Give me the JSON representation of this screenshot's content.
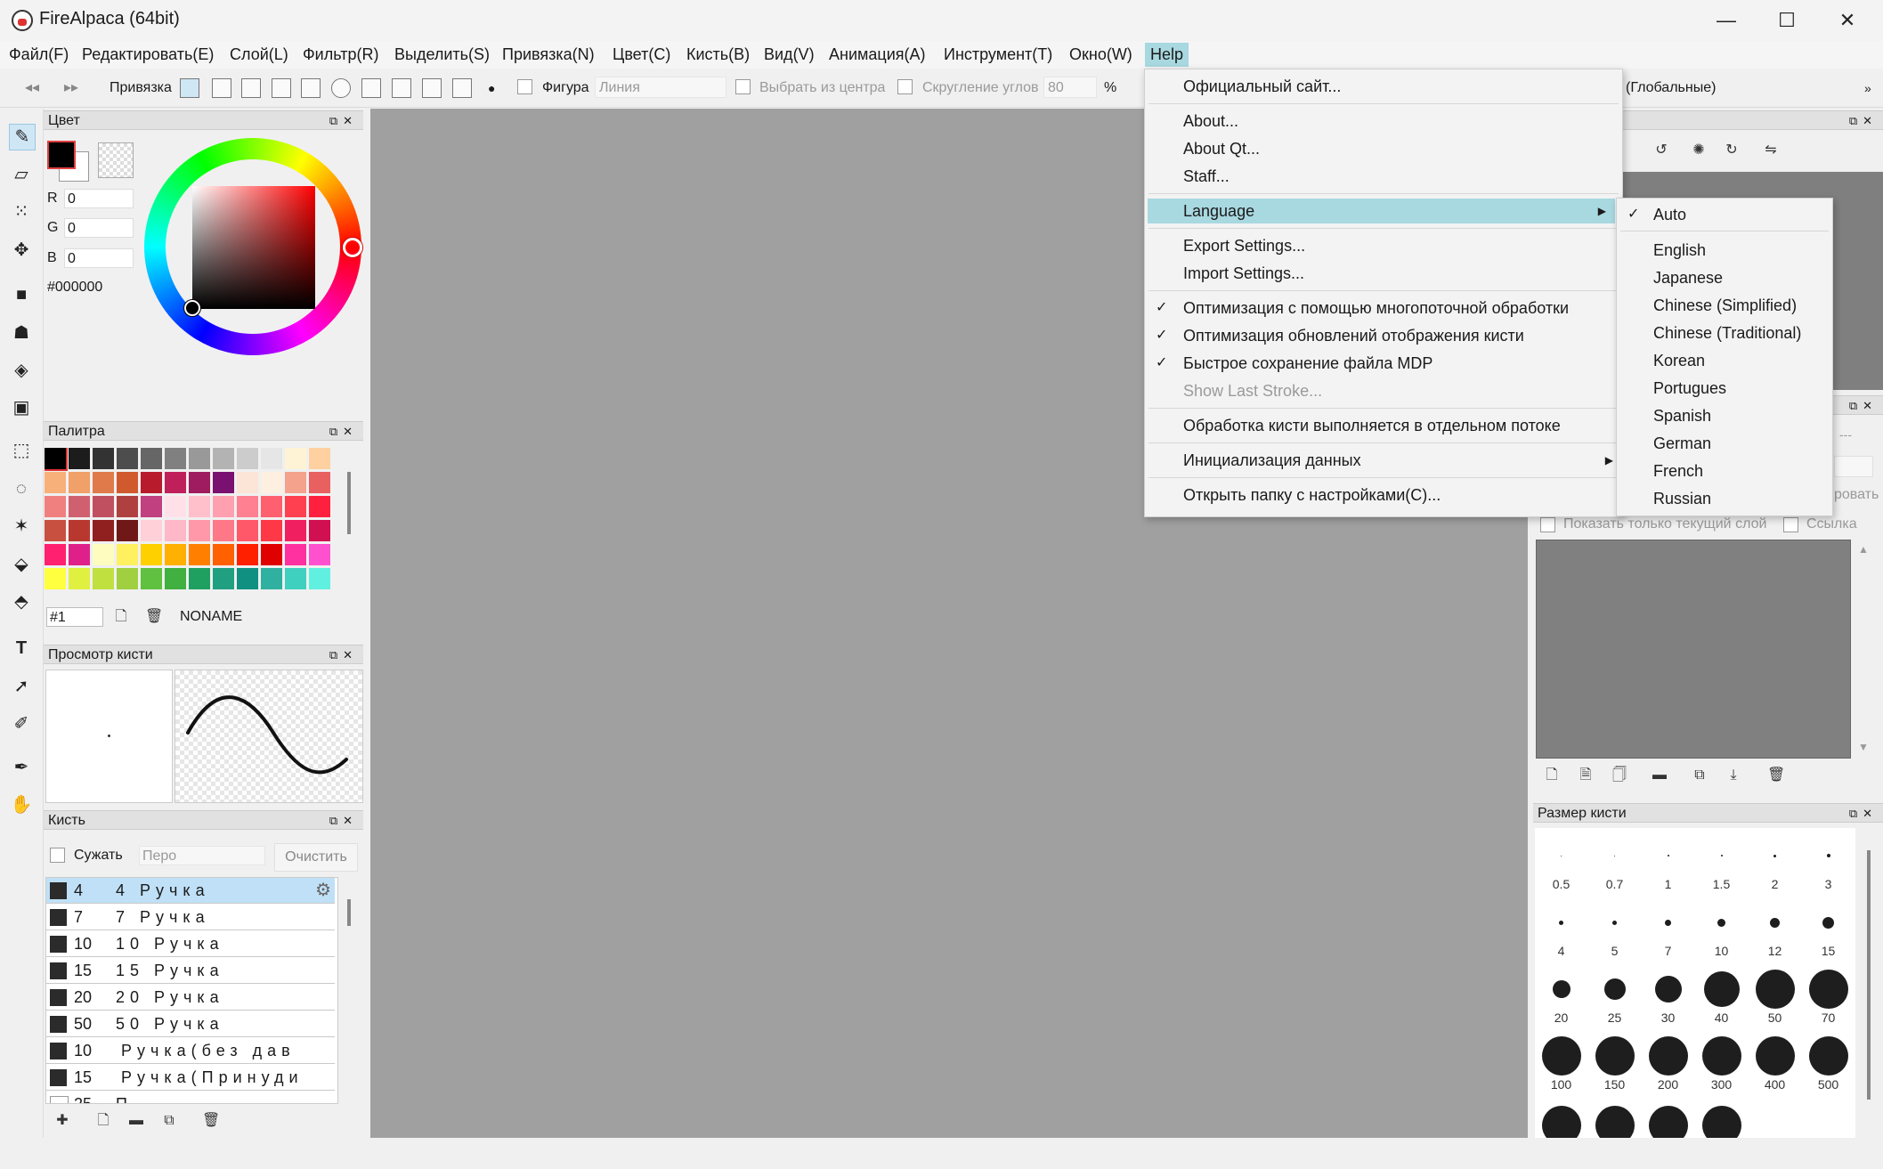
{
  "window": {
    "title": "FireAlpaca (64bit)",
    "minimize": "—",
    "maximize": "☐",
    "close": "✕"
  },
  "menubar": [
    "Файл(F)",
    "Редактировать(E)",
    "Слой(L)",
    "Фильтр(R)",
    "Выделить(S)",
    "Привязка(N)",
    "Цвет(C)",
    "Кисть(B)",
    "Вид(V)",
    "Анимация(A)",
    "Инструмент(T)",
    "Окно(W)",
    "Help"
  ],
  "toolbar": {
    "snap_label": "Привязка",
    "shape_label": "Фигура",
    "shape_value": "Линия",
    "select_center_label": "Выбрать из центра",
    "round_corners_label": "Скругление углов",
    "round_value": "80",
    "percent": "%",
    "global_label": "(Глобальные)",
    "overflow": "»"
  },
  "color_panel": {
    "title": "Цвет",
    "r_label": "R",
    "r_value": "0",
    "g_label": "G",
    "g_value": "0",
    "b_label": "B",
    "b_value": "0",
    "hex": "#000000"
  },
  "palette_panel": {
    "title": "Палитра",
    "palette_number": "#1",
    "palette_name": "NONAME",
    "colors": [
      [
        "#000000",
        "#1c1c1c",
        "#333333",
        "#4d4d4d",
        "#666666",
        "#808080",
        "#999999",
        "#b3b3b3",
        "#cccccc",
        "#e6e6e6",
        "#fff3d6",
        "#ffd1a0"
      ],
      [
        "#f7b07a",
        "#f0a068",
        "#e07a4a",
        "#d05a2e",
        "#b81c2c",
        "#c0205a",
        "#a01c60",
        "#7a1070",
        "#fce4d6",
        "#fdf0e0",
        "#f4a28c",
        "#e86060"
      ],
      [
        "#f08080",
        "#d06070",
        "#c05060",
        "#b04040",
        "#c04080",
        "#ffe0e8",
        "#ffc0cc",
        "#ffa0b0",
        "#ff8090",
        "#ff6070",
        "#ff4050",
        "#ff2040"
      ],
      [
        "#c85040",
        "#b83830",
        "#902020",
        "#701818",
        "#ffd0d8",
        "#ffb8c8",
        "#ff98a8",
        "#ff7888",
        "#ff5868",
        "#ff3848",
        "#f02060",
        "#d01050"
      ],
      [
        "#ff2070",
        "#e0208a",
        "#fffcc0",
        "#fff060",
        "#ffd000",
        "#ffb000",
        "#ff8000",
        "#ff6000",
        "#ff2000",
        "#e00000",
        "#ff30a0",
        "#ff50d0"
      ],
      [
        "#ffff40",
        "#e0f040",
        "#c0e040",
        "#a0d040",
        "#60c040",
        "#40b040",
        "#20a060",
        "#20a080",
        "#109080",
        "#30b0a0",
        "#40d0c0",
        "#60f0e0"
      ]
    ]
  },
  "brush_preview": {
    "title": "Просмотр кисти"
  },
  "brush_panel": {
    "title": "Кисть",
    "shrink_label": "Сужать",
    "search_placeholder": "Перо",
    "clear_label": "Очистить",
    "items": [
      {
        "size": "4",
        "name": "4 Ручка"
      },
      {
        "size": "7",
        "name": "7 Ручка"
      },
      {
        "size": "10",
        "name": "10 Ручка"
      },
      {
        "size": "15",
        "name": "15 Ручка"
      },
      {
        "size": "20",
        "name": "20 Ручка"
      },
      {
        "size": "50",
        "name": "50 Ручка"
      },
      {
        "size": "10",
        "name": "Ручка(без дав"
      },
      {
        "size": "15",
        "name": "Ручка(Принуди"
      },
      {
        "size": "25",
        "name": "П"
      }
    ]
  },
  "layer_panel": {
    "show_current_only": "Показать только текущий слой",
    "link_label": "Ссылка",
    "partial_text": "ровать",
    "dashes": "---"
  },
  "brush_size_panel": {
    "title": "Размер кисти",
    "sizes": [
      "0.5",
      "0.7",
      "1",
      "1.5",
      "2",
      "3",
      "4",
      "5",
      "7",
      "10",
      "12",
      "15",
      "20",
      "25",
      "30",
      "40",
      "50",
      "70",
      "100",
      "150",
      "200",
      "300",
      "400",
      "500",
      "",
      "",
      "",
      ""
    ]
  },
  "help_menu": {
    "items": {
      "official_site": "Официальный сайт...",
      "about": "About...",
      "about_qt": "About Qt...",
      "staff": "Staff...",
      "language": "Language",
      "export_settings": "Export Settings...",
      "import_settings": "Import Settings...",
      "opt_multithread": "Оптимизация с помощью многопоточной обработки",
      "opt_brush_display": "Оптимизация обновлений отображения кисти",
      "fast_save_mdp": "Быстрое сохранение файла MDP",
      "show_last_stroke": "Show Last Stroke...",
      "brush_separate_thread": "Обработка кисти выполняется в отдельном потоке",
      "init_data": "Инициализация данных",
      "open_settings_folder": "Открыть папку с настройками(C)..."
    },
    "check": "✓",
    "submenu_arrow": "▶"
  },
  "language_menu": [
    "Auto",
    "English",
    "Japanese",
    "Chinese (Simplified)",
    "Chinese (Traditional)",
    "Korean",
    "Portugues",
    "Spanish",
    "German",
    "French",
    "Russian"
  ]
}
